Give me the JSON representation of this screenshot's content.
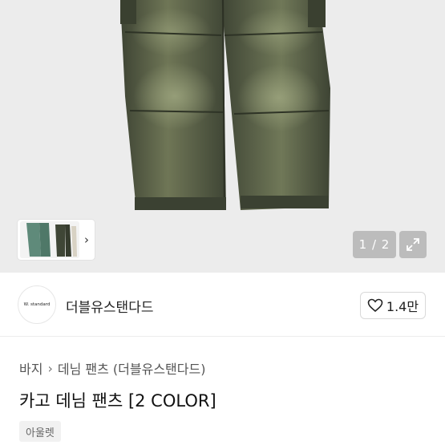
{
  "product_image": {
    "page_indicator": "1 / 2"
  },
  "store": {
    "logo_text": "W. standard",
    "name": "더블유스탠다드",
    "likes": "1.4만"
  },
  "breadcrumb": {
    "level1": "바지",
    "level2": "데님 팬츠 (더블유스탠다드)"
  },
  "product": {
    "title": "카고 데님 팬츠 [2 COLOR]",
    "badge": "아울렛"
  },
  "colors": {
    "denim": "#4f5641",
    "background": "#ececec"
  }
}
